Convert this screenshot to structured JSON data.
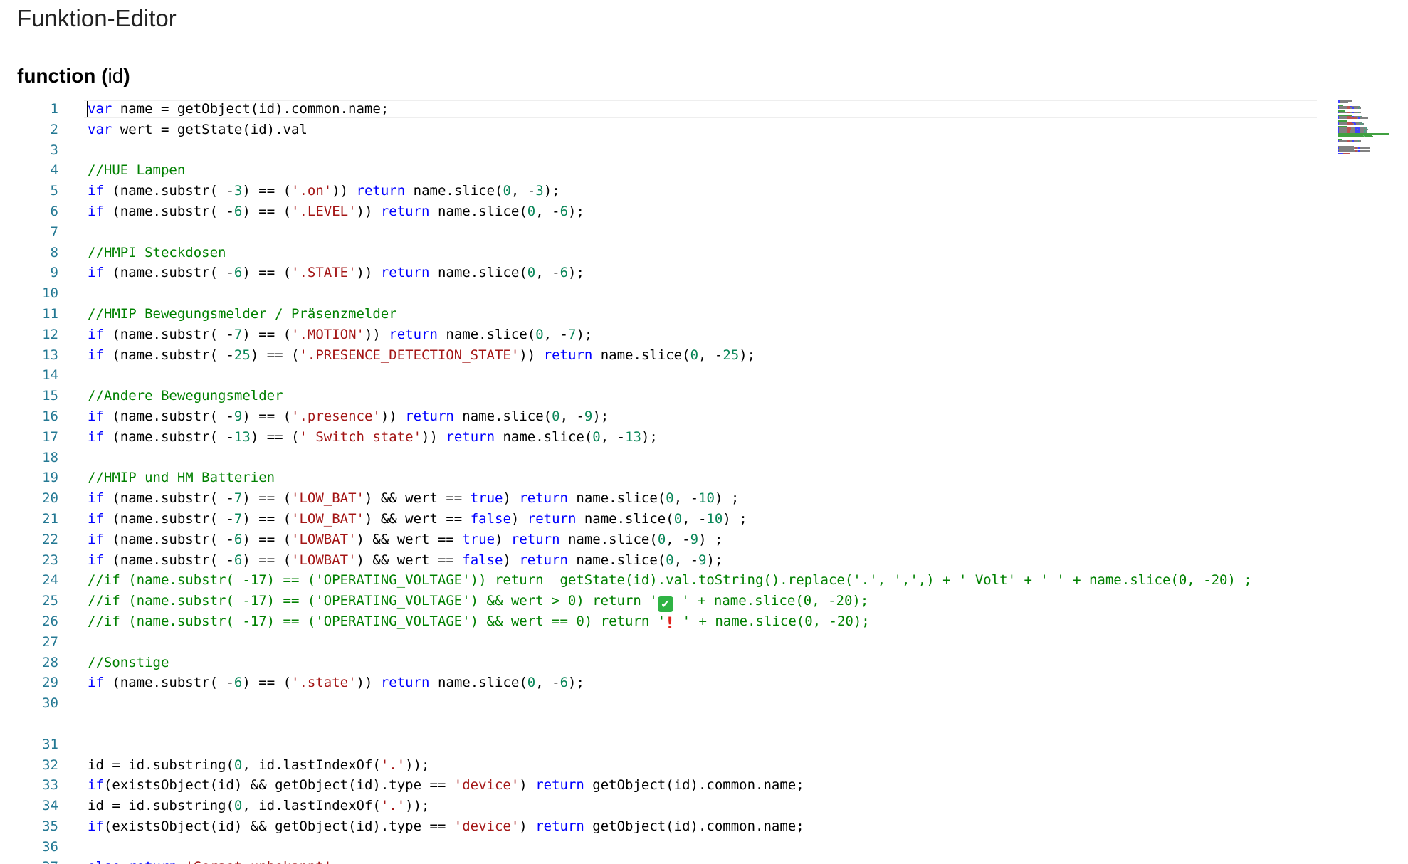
{
  "page": {
    "title": "Funktion-Editor"
  },
  "function_signature": {
    "keyword": "function",
    "open_paren": "(",
    "param": "id",
    "close_paren": ")"
  },
  "editor": {
    "current_line": 1,
    "lines": [
      {
        "n": "1",
        "t": [
          [
            "k",
            "var"
          ],
          [
            "p",
            " name = getObject(id).common.name;"
          ]
        ]
      },
      {
        "n": "2",
        "t": [
          [
            "k",
            "var"
          ],
          [
            "p",
            " wert = getState(id).val"
          ]
        ]
      },
      {
        "n": "3",
        "t": []
      },
      {
        "n": "4",
        "t": [
          [
            "c",
            "//HUE Lampen"
          ]
        ]
      },
      {
        "n": "5",
        "t": [
          [
            "k",
            "if"
          ],
          [
            "p",
            " (name.substr( -"
          ],
          [
            "n",
            "3"
          ],
          [
            "p",
            ") == ("
          ],
          [
            "s",
            "'.on'"
          ],
          [
            "p",
            ")) "
          ],
          [
            "k",
            "return"
          ],
          [
            "p",
            " name.slice("
          ],
          [
            "n",
            "0"
          ],
          [
            "p",
            ", -"
          ],
          [
            "n",
            "3"
          ],
          [
            "p",
            ");"
          ]
        ]
      },
      {
        "n": "6",
        "t": [
          [
            "k",
            "if"
          ],
          [
            "p",
            " (name.substr( -"
          ],
          [
            "n",
            "6"
          ],
          [
            "p",
            ") == ("
          ],
          [
            "s",
            "'.LEVEL'"
          ],
          [
            "p",
            ")) "
          ],
          [
            "k",
            "return"
          ],
          [
            "p",
            " name.slice("
          ],
          [
            "n",
            "0"
          ],
          [
            "p",
            ", -"
          ],
          [
            "n",
            "6"
          ],
          [
            "p",
            ");"
          ]
        ]
      },
      {
        "n": "7",
        "t": []
      },
      {
        "n": "8",
        "t": [
          [
            "c",
            "//HMPI Steckdosen"
          ]
        ]
      },
      {
        "n": "9",
        "t": [
          [
            "k",
            "if"
          ],
          [
            "p",
            " (name.substr( -"
          ],
          [
            "n",
            "6"
          ],
          [
            "p",
            ") == ("
          ],
          [
            "s",
            "'.STATE'"
          ],
          [
            "p",
            ")) "
          ],
          [
            "k",
            "return"
          ],
          [
            "p",
            " name.slice("
          ],
          [
            "n",
            "0"
          ],
          [
            "p",
            ", -"
          ],
          [
            "n",
            "6"
          ],
          [
            "p",
            ");"
          ]
        ]
      },
      {
        "n": "10",
        "t": []
      },
      {
        "n": "11",
        "t": [
          [
            "c",
            "//HMIP Bewegungsmelder / Präsenzmelder"
          ]
        ]
      },
      {
        "n": "12",
        "t": [
          [
            "k",
            "if"
          ],
          [
            "p",
            " (name.substr( -"
          ],
          [
            "n",
            "7"
          ],
          [
            "p",
            ") == ("
          ],
          [
            "s",
            "'.MOTION'"
          ],
          [
            "p",
            ")) "
          ],
          [
            "k",
            "return"
          ],
          [
            "p",
            " name.slice("
          ],
          [
            "n",
            "0"
          ],
          [
            "p",
            ", -"
          ],
          [
            "n",
            "7"
          ],
          [
            "p",
            ");"
          ]
        ]
      },
      {
        "n": "13",
        "t": [
          [
            "k",
            "if"
          ],
          [
            "p",
            " (name.substr( -"
          ],
          [
            "n",
            "25"
          ],
          [
            "p",
            ") == ("
          ],
          [
            "s",
            "'.PRESENCE_DETECTION_STATE'"
          ],
          [
            "p",
            ")) "
          ],
          [
            "k",
            "return"
          ],
          [
            "p",
            " name.slice("
          ],
          [
            "n",
            "0"
          ],
          [
            "p",
            ", -"
          ],
          [
            "n",
            "25"
          ],
          [
            "p",
            ");"
          ]
        ]
      },
      {
        "n": "14",
        "t": []
      },
      {
        "n": "15",
        "t": [
          [
            "c",
            "//Andere Bewegungsmelder"
          ]
        ]
      },
      {
        "n": "16",
        "t": [
          [
            "k",
            "if"
          ],
          [
            "p",
            " (name.substr( -"
          ],
          [
            "n",
            "9"
          ],
          [
            "p",
            ") == ("
          ],
          [
            "s",
            "'.presence'"
          ],
          [
            "p",
            ")) "
          ],
          [
            "k",
            "return"
          ],
          [
            "p",
            " name.slice("
          ],
          [
            "n",
            "0"
          ],
          [
            "p",
            ", -"
          ],
          [
            "n",
            "9"
          ],
          [
            "p",
            ");"
          ]
        ]
      },
      {
        "n": "17",
        "t": [
          [
            "k",
            "if"
          ],
          [
            "p",
            " (name.substr( -"
          ],
          [
            "n",
            "13"
          ],
          [
            "p",
            ") == ("
          ],
          [
            "s",
            "' Switch state'"
          ],
          [
            "p",
            ")) "
          ],
          [
            "k",
            "return"
          ],
          [
            "p",
            " name.slice("
          ],
          [
            "n",
            "0"
          ],
          [
            "p",
            ", -"
          ],
          [
            "n",
            "13"
          ],
          [
            "p",
            ");"
          ]
        ]
      },
      {
        "n": "18",
        "t": []
      },
      {
        "n": "19",
        "t": [
          [
            "c",
            "//HMIP und HM Batterien"
          ]
        ]
      },
      {
        "n": "20",
        "t": [
          [
            "k",
            "if"
          ],
          [
            "p",
            " (name.substr( -"
          ],
          [
            "n",
            "7"
          ],
          [
            "p",
            ") == ("
          ],
          [
            "s",
            "'LOW_BAT'"
          ],
          [
            "p",
            ") && wert == "
          ],
          [
            "k",
            "true"
          ],
          [
            "p",
            ") "
          ],
          [
            "k",
            "return"
          ],
          [
            "p",
            " name.slice("
          ],
          [
            "n",
            "0"
          ],
          [
            "p",
            ", -"
          ],
          [
            "n",
            "10"
          ],
          [
            "p",
            ") ;"
          ]
        ]
      },
      {
        "n": "21",
        "t": [
          [
            "k",
            "if"
          ],
          [
            "p",
            " (name.substr( -"
          ],
          [
            "n",
            "7"
          ],
          [
            "p",
            ") == ("
          ],
          [
            "s",
            "'LOW_BAT'"
          ],
          [
            "p",
            ") && wert == "
          ],
          [
            "k",
            "false"
          ],
          [
            "p",
            ") "
          ],
          [
            "k",
            "return"
          ],
          [
            "p",
            " name.slice("
          ],
          [
            "n",
            "0"
          ],
          [
            "p",
            ", -"
          ],
          [
            "n",
            "10"
          ],
          [
            "p",
            ") ;"
          ]
        ]
      },
      {
        "n": "22",
        "t": [
          [
            "k",
            "if"
          ],
          [
            "p",
            " (name.substr( -"
          ],
          [
            "n",
            "6"
          ],
          [
            "p",
            ") == ("
          ],
          [
            "s",
            "'LOWBAT'"
          ],
          [
            "p",
            ") && wert == "
          ],
          [
            "k",
            "true"
          ],
          [
            "p",
            ") "
          ],
          [
            "k",
            "return"
          ],
          [
            "p",
            " name.slice("
          ],
          [
            "n",
            "0"
          ],
          [
            "p",
            ", -"
          ],
          [
            "n",
            "9"
          ],
          [
            "p",
            ") ;"
          ]
        ]
      },
      {
        "n": "23",
        "t": [
          [
            "k",
            "if"
          ],
          [
            "p",
            " (name.substr( -"
          ],
          [
            "n",
            "6"
          ],
          [
            "p",
            ") == ("
          ],
          [
            "s",
            "'LOWBAT'"
          ],
          [
            "p",
            ") && wert == "
          ],
          [
            "k",
            "false"
          ],
          [
            "p",
            ") "
          ],
          [
            "k",
            "return"
          ],
          [
            "p",
            " name.slice("
          ],
          [
            "n",
            "0"
          ],
          [
            "p",
            ", -"
          ],
          [
            "n",
            "9"
          ],
          [
            "p",
            ");"
          ]
        ]
      },
      {
        "n": "24",
        "t": [
          [
            "c",
            "//if (name.substr( -17) == ('OPERATING_VOLTAGE')) return  getState(id).val.toString().replace('.', ',',) + ' Volt' + ' ' + name.slice(0, -20) ;"
          ]
        ]
      },
      {
        "n": "25",
        "t": [
          [
            "c",
            "//if (name.substr( -17) == ('OPERATING_VOLTAGE') && wert > 0) return '"
          ],
          [
            "e",
            "check"
          ],
          [
            "c",
            " ' + name.slice(0, -20);"
          ]
        ]
      },
      {
        "n": "26",
        "t": [
          [
            "c",
            "//if (name.substr( -17) == ('OPERATING_VOLTAGE') && wert == 0) return '"
          ],
          [
            "e",
            "excl"
          ],
          [
            "c",
            " ' + name.slice(0, -20);"
          ]
        ]
      },
      {
        "n": "27",
        "t": []
      },
      {
        "n": "28",
        "t": [
          [
            "c",
            "//Sonstige"
          ]
        ]
      },
      {
        "n": "29",
        "t": [
          [
            "k",
            "if"
          ],
          [
            "p",
            " (name.substr( -"
          ],
          [
            "n",
            "6"
          ],
          [
            "p",
            ") == ("
          ],
          [
            "s",
            "'.state'"
          ],
          [
            "p",
            ")) "
          ],
          [
            "k",
            "return"
          ],
          [
            "p",
            " name.slice("
          ],
          [
            "n",
            "0"
          ],
          [
            "p",
            ", -"
          ],
          [
            "n",
            "6"
          ],
          [
            "p",
            ");"
          ]
        ]
      },
      {
        "n": "30",
        "t": []
      },
      {
        "n": "",
        "t": []
      },
      {
        "n": "31",
        "t": []
      },
      {
        "n": "32",
        "t": [
          [
            "p",
            "id = id.substring("
          ],
          [
            "n",
            "0"
          ],
          [
            "p",
            ", id.lastIndexOf("
          ],
          [
            "s",
            "'.'"
          ],
          [
            "p",
            "));"
          ]
        ]
      },
      {
        "n": "33",
        "t": [
          [
            "k",
            "if"
          ],
          [
            "p",
            "(existsObject(id) && getObject(id).type == "
          ],
          [
            "s",
            "'device'"
          ],
          [
            "p",
            ") "
          ],
          [
            "k",
            "return"
          ],
          [
            "p",
            " getObject(id).common.name;"
          ]
        ]
      },
      {
        "n": "34",
        "t": [
          [
            "p",
            "id = id.substring("
          ],
          [
            "n",
            "0"
          ],
          [
            "p",
            ", id.lastIndexOf("
          ],
          [
            "s",
            "'.'"
          ],
          [
            "p",
            "));"
          ]
        ]
      },
      {
        "n": "35",
        "t": [
          [
            "k",
            "if"
          ],
          [
            "p",
            "(existsObject(id) && getObject(id).type == "
          ],
          [
            "s",
            "'device'"
          ],
          [
            "p",
            ") "
          ],
          [
            "k",
            "return"
          ],
          [
            "p",
            " getObject(id).common.name;"
          ]
        ]
      },
      {
        "n": "36",
        "t": []
      },
      {
        "n": "37",
        "t": [
          [
            "k",
            "else"
          ],
          [
            "p",
            " "
          ],
          [
            "k",
            "return"
          ],
          [
            "p",
            " "
          ],
          [
            "s",
            "'Geraet unbekannt'"
          ],
          [
            "p",
            ";"
          ]
        ]
      },
      {
        "n": "38",
        "t": []
      }
    ]
  },
  "colors": {
    "keyword": "#0000ff",
    "string": "#a31515",
    "number": "#098658",
    "comment": "#008000",
    "line_number": "#237893"
  },
  "icons": {
    "check": "white-heavy-check-mark-icon",
    "excl": "heavy-exclamation-mark-icon"
  }
}
